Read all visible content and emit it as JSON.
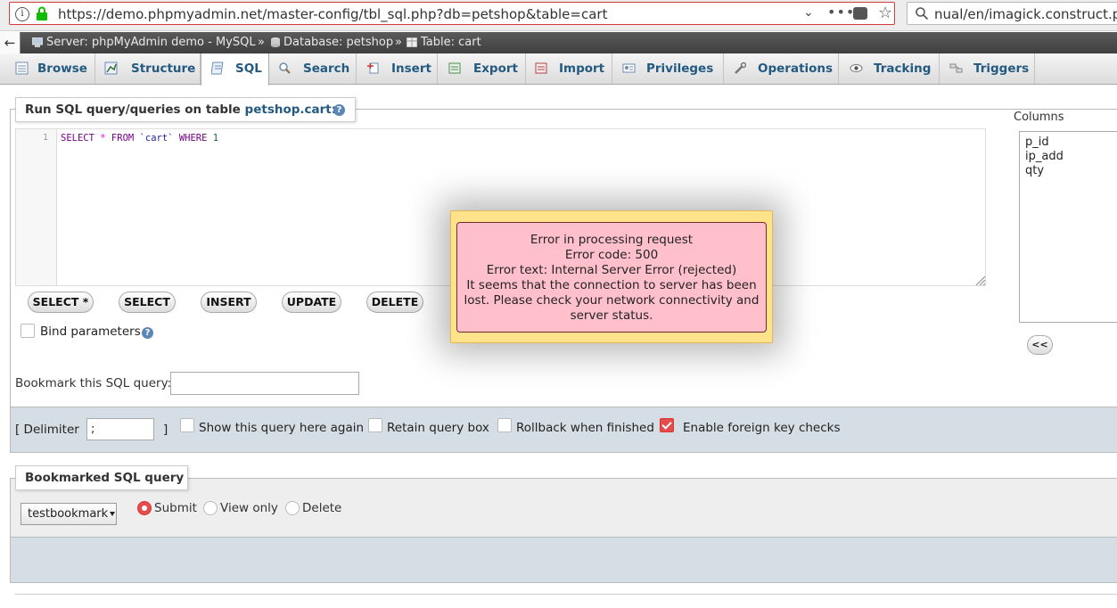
{
  "browser": {
    "url": "https://demo.phpmyadmin.net/master-config/tbl_sql.php?db=petshop&table=cart",
    "search_text": "nual/en/imagick.construct.php",
    "info_glyph": "i"
  },
  "breadcrumb": {
    "back": "←",
    "server": "Server: phpMyAdmin demo - MySQL",
    "sep1": "»",
    "database": "Database: petshop",
    "sep2": "»",
    "table": "Table: cart"
  },
  "tabs": [
    {
      "label": "Browse",
      "icon": "browse-icon"
    },
    {
      "label": "Structure",
      "icon": "structure-icon"
    },
    {
      "label": "SQL",
      "icon": "sql-icon",
      "active": true
    },
    {
      "label": "Search",
      "icon": "search-icon"
    },
    {
      "label": "Insert",
      "icon": "insert-icon"
    },
    {
      "label": "Export",
      "icon": "export-icon"
    },
    {
      "label": "Import",
      "icon": "import-icon"
    },
    {
      "label": "Privileges",
      "icon": "privileges-icon"
    },
    {
      "label": "Operations",
      "icon": "operations-icon"
    },
    {
      "label": "Tracking",
      "icon": "tracking-icon"
    },
    {
      "label": "Triggers",
      "icon": "triggers-icon"
    }
  ],
  "sql_panel": {
    "legend_prefix": "Run SQL query/queries on table ",
    "legend_link": "petshop.cart:",
    "help_glyph": "?",
    "line_number": "1",
    "query": {
      "select": "SELECT",
      "star": "*",
      "from": "FROM",
      "table": "`cart`",
      "where": "WHERE",
      "value": "1"
    },
    "buttons": {
      "select_star": "SELECT *",
      "select": "SELECT",
      "insert": "INSERT",
      "update": "UPDATE",
      "delete": "DELETE"
    },
    "bind_parameters": "Bind parameters",
    "bookmark_label": "Bookmark this SQL query:",
    "bookmark_value": ""
  },
  "columns": {
    "label": "Columns",
    "items": [
      "p_id",
      "ip_add",
      "qty"
    ],
    "insert_button": "<<"
  },
  "options": {
    "delimiter_open": "[ Delimiter",
    "delimiter_value": ";",
    "delimiter_close": "]",
    "show_query_again": {
      "label": "Show this query here again",
      "checked": false
    },
    "retain_query_box": {
      "label": "Retain query box",
      "checked": false
    },
    "rollback": {
      "label": "Rollback when finished",
      "checked": false
    },
    "foreign_key_checks": {
      "label": "Enable foreign key checks",
      "checked": true
    }
  },
  "bookmarked": {
    "legend": "Bookmarked SQL query",
    "selected": "testbookmark",
    "radios": [
      {
        "label": "Submit",
        "checked": true
      },
      {
        "label": "View only",
        "checked": false
      },
      {
        "label": "Delete",
        "checked": false
      }
    ]
  },
  "error": {
    "line1": "Error in processing request",
    "line2": "Error code: 500",
    "line3": "Error text: Internal Server Error (rejected)",
    "line4": "It seems that the connection to server has been",
    "line5": "lost. Please check your network connectivity and",
    "line6": "server status."
  },
  "colors": {
    "link_blue": "#235a81",
    "error_bg": "#ffc0cb",
    "error_frame": "#ffe38b",
    "checked_red": "#e34d4d"
  }
}
